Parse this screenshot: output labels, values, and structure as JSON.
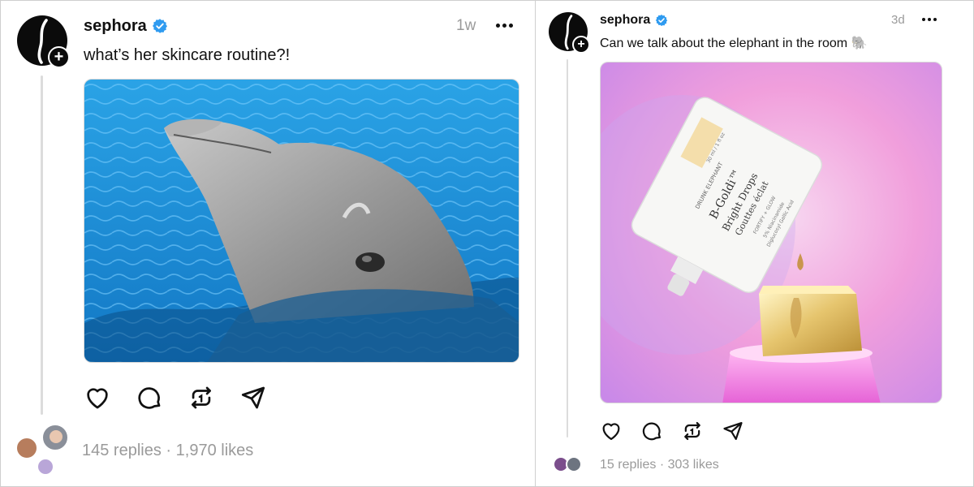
{
  "posts": [
    {
      "username": "sephora",
      "timestamp": "1w",
      "text": "what’s her skincare routine?!",
      "image": "dolphin-photo",
      "actions": [
        "heart-icon",
        "comment-icon",
        "repost-icon",
        "share-icon"
      ],
      "replies": "145 replies",
      "separator": "·",
      "likes": "1,970 likes"
    },
    {
      "username": "sephora",
      "timestamp": "3d",
      "text": "Can we talk about the elephant in the room 🐘",
      "image": "product-photo",
      "product_label": {
        "brand": "DRUNK ELEPHANT",
        "name_line1": "B-Goldi™",
        "name_line2": "Bright Drops",
        "name_line3": "Gouttes éclat",
        "ingredients": "5% Niacinamide",
        "ingredients2": "Diglucosyl Gallic Acid",
        "size": "30 ml / 1 fl oz",
        "tag": "FORTIFY + GLOW"
      },
      "actions": [
        "heart-icon",
        "comment-icon",
        "repost-icon",
        "share-icon"
      ],
      "replies": "15 replies",
      "separator": "·",
      "likes": "303 likes"
    }
  ],
  "colors": {
    "verified": "#2f9bf0",
    "muted": "#9a9a9a",
    "text": "#111111",
    "pool": "#1e8fd6",
    "pink_bg": "#f3a7df"
  }
}
